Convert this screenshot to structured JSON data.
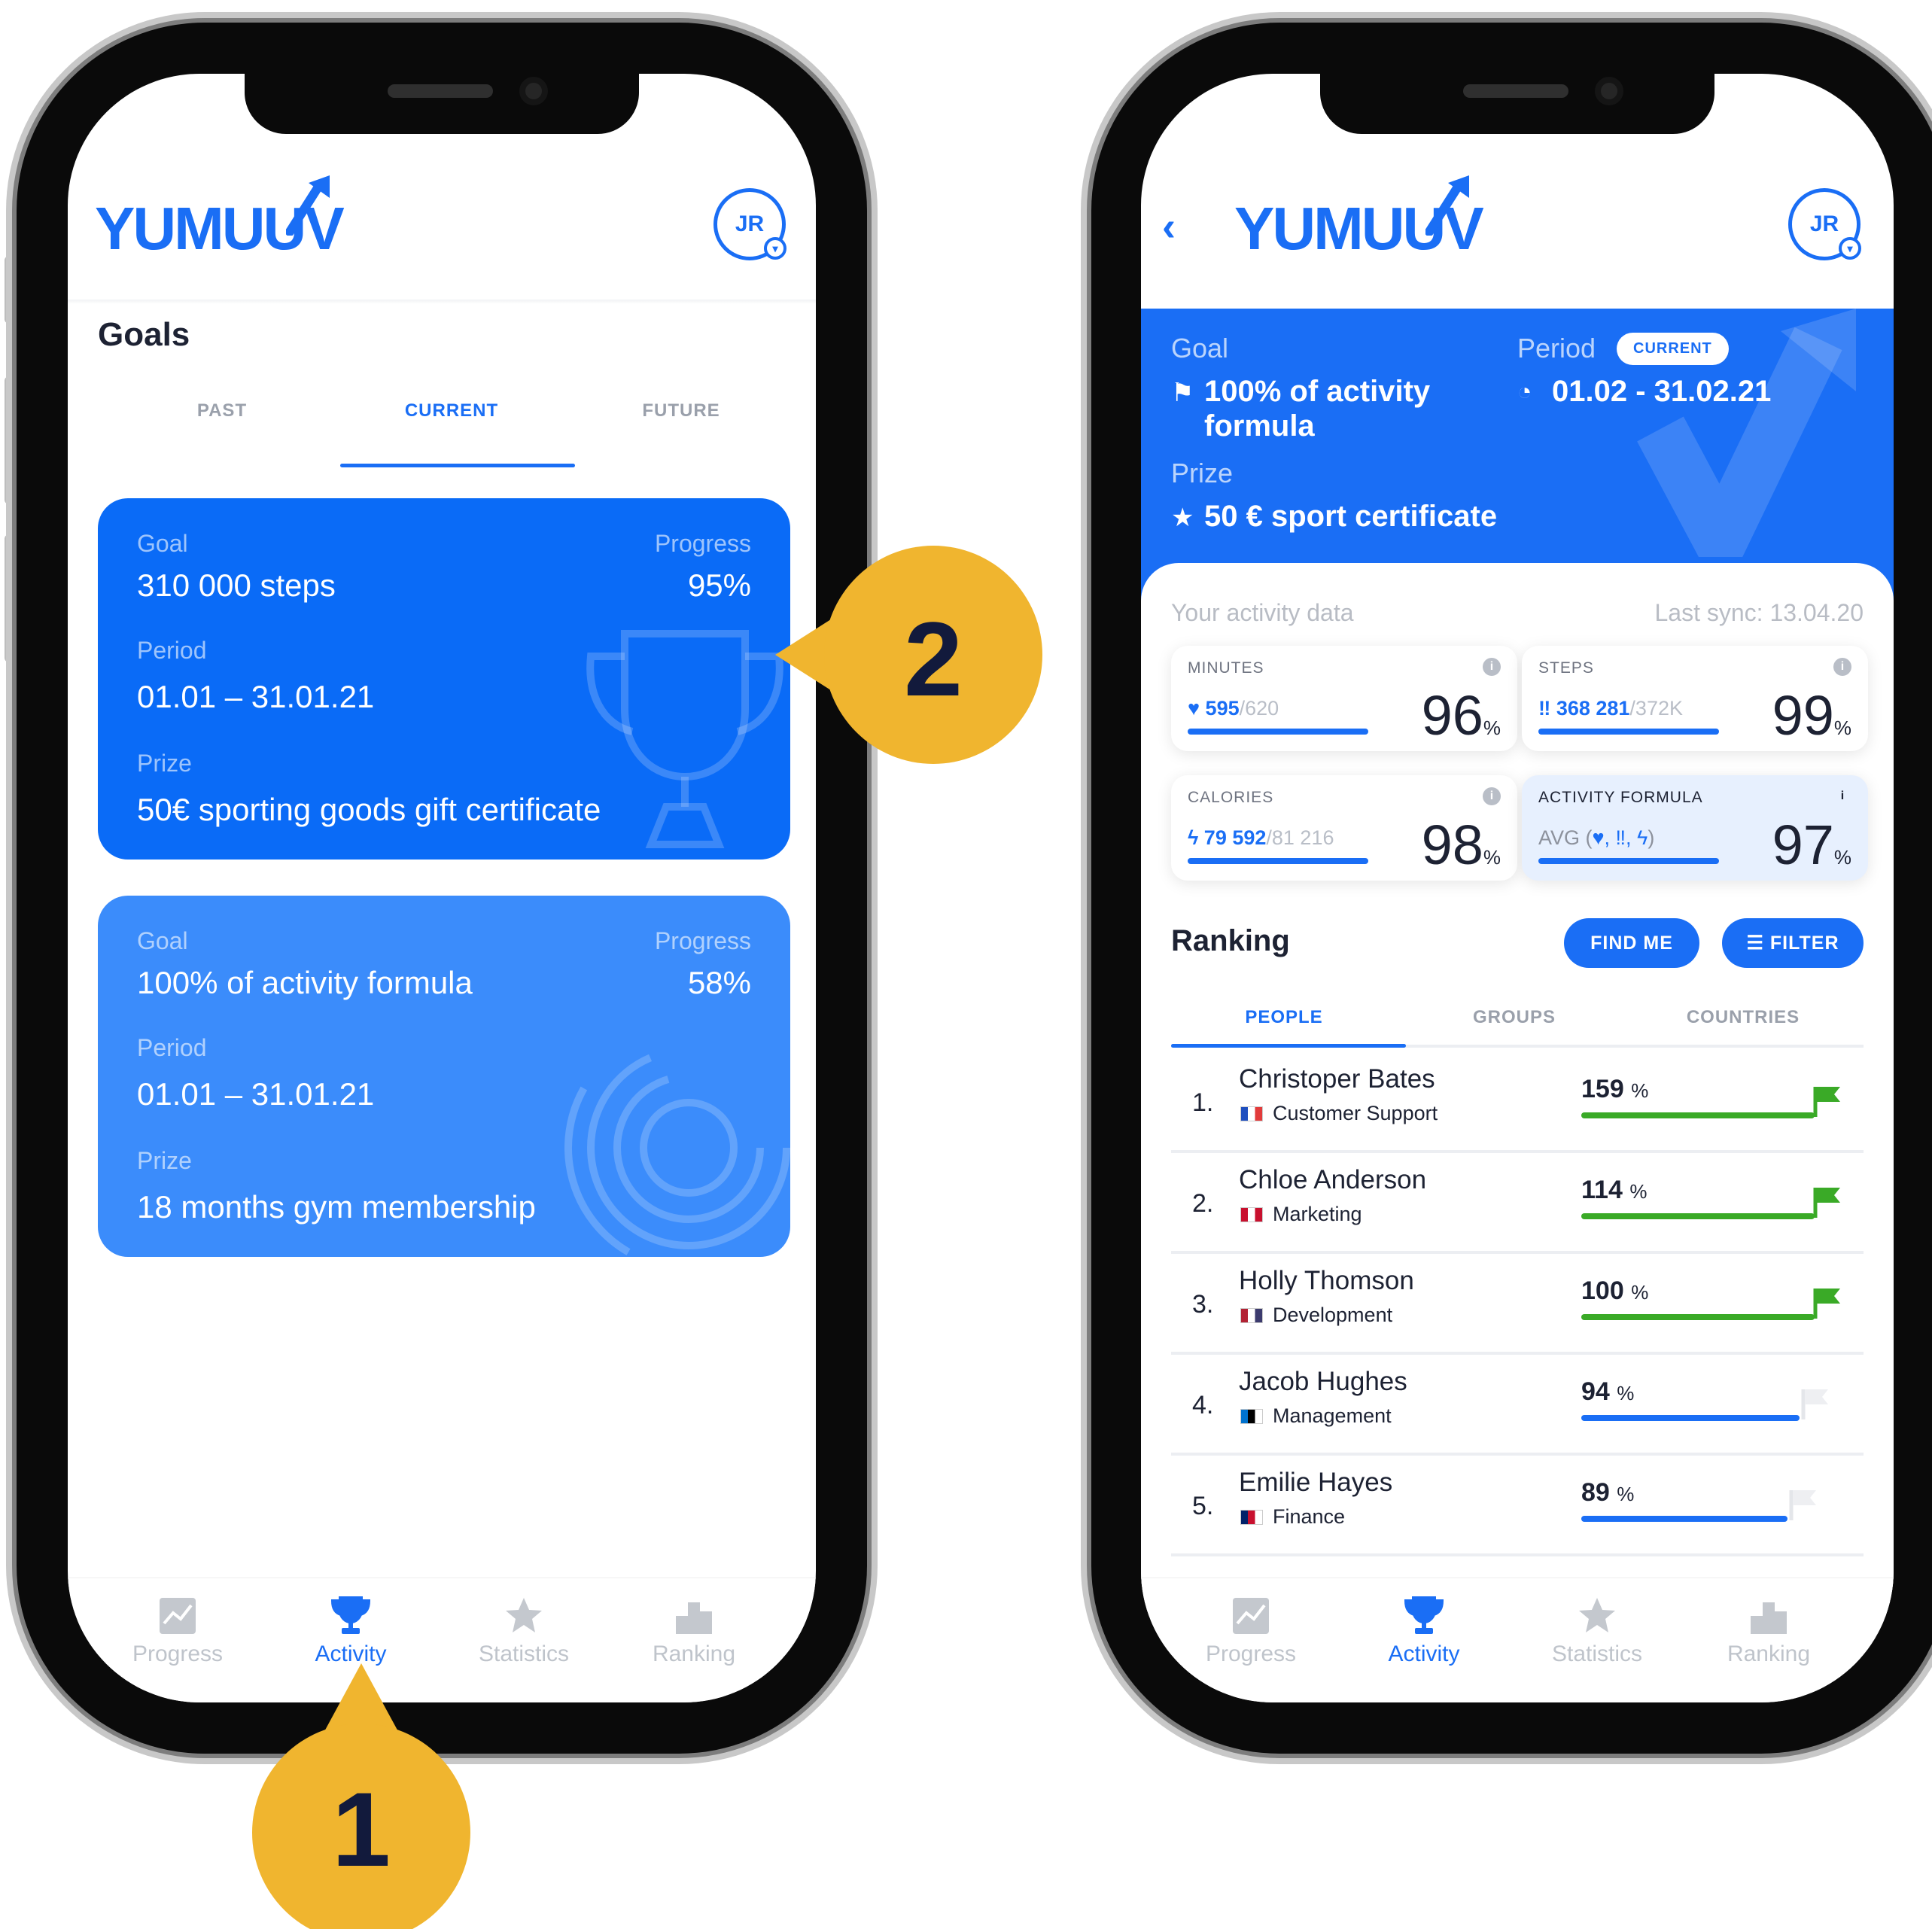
{
  "left": {
    "brand": "YUMUUV",
    "avatar": "JR",
    "page_title": "Goals",
    "tabs": [
      "PAST",
      "CURRENT",
      "FUTURE"
    ],
    "cards": [
      {
        "goal_label": "Goal",
        "goal": "310 000 steps",
        "progress_label": "Progress",
        "progress": "95%",
        "period_label": "Period",
        "period": "01.01 – 31.01.21",
        "prize_label": "Prize",
        "prize": "50€ sporting goods gift certificate"
      },
      {
        "goal_label": "Goal",
        "goal": "100% of activity formula",
        "progress_label": "Progress",
        "progress": "58%",
        "period_label": "Period",
        "period": "01.01 – 31.01.21",
        "prize_label": "Prize",
        "prize": "18 months gym membership"
      }
    ],
    "nav": [
      "Progress",
      "Activity",
      "Statistics",
      "Ranking"
    ]
  },
  "callouts": {
    "one": "1",
    "two": "2"
  },
  "right": {
    "brand": "YUMUUV",
    "avatar": "JR",
    "goal_label": "Goal",
    "goal_line1": "100% of activity",
    "goal_line2": "formula",
    "period_label": "Period",
    "period_badge": "CURRENT",
    "period": "01.02 - 31.02.21",
    "prize_label": "Prize",
    "prize": "50 € sport certificate",
    "activity_title": "Your activity data",
    "last_sync": "Last sync: 13.04.20",
    "stats": [
      {
        "title": "MINUTES",
        "value": "595",
        "of": "/620",
        "pct": "96",
        "unit": "%"
      },
      {
        "title": "STEPS",
        "value": "368 281",
        "of": "/372K",
        "pct": "99",
        "unit": "%"
      },
      {
        "title": "CALORIES",
        "value": "79 592",
        "of": "/81 216",
        "pct": "98",
        "unit": "%"
      },
      {
        "title": "ACTIVITY FORMULA",
        "value": "AVG (",
        "of": ")",
        "pct": "97",
        "unit": "%"
      }
    ],
    "ranking_title": "Ranking",
    "find_me": "FIND ME",
    "filter": "FILTER",
    "rank_tabs": [
      "PEOPLE",
      "GROUPS",
      "COUNTRIES"
    ],
    "ranking": [
      {
        "n": "1.",
        "name": "Christoper Bates",
        "dept": "Customer Support",
        "pct": "159",
        "unit": "%",
        "value": 159,
        "color": "#3aaa27"
      },
      {
        "n": "2.",
        "name": "Chloe Anderson",
        "dept": "Marketing",
        "pct": "114",
        "unit": "%",
        "value": 114,
        "color": "#3aaa27"
      },
      {
        "n": "3.",
        "name": "Holly Thomson",
        "dept": "Development",
        "pct": "100",
        "unit": "%",
        "value": 100,
        "color": "#3aaa27"
      },
      {
        "n": "4.",
        "name": "Jacob Hughes",
        "dept": "Management",
        "pct": "94",
        "unit": "%",
        "value": 94,
        "color": "#1a6ef5"
      },
      {
        "n": "5.",
        "name": "Emilie Hayes",
        "dept": "Finance",
        "pct": "89",
        "unit": "%",
        "value": 89,
        "color": "#1a6ef5"
      }
    ],
    "nav": [
      "Progress",
      "Activity",
      "Statistics",
      "Ranking"
    ]
  }
}
